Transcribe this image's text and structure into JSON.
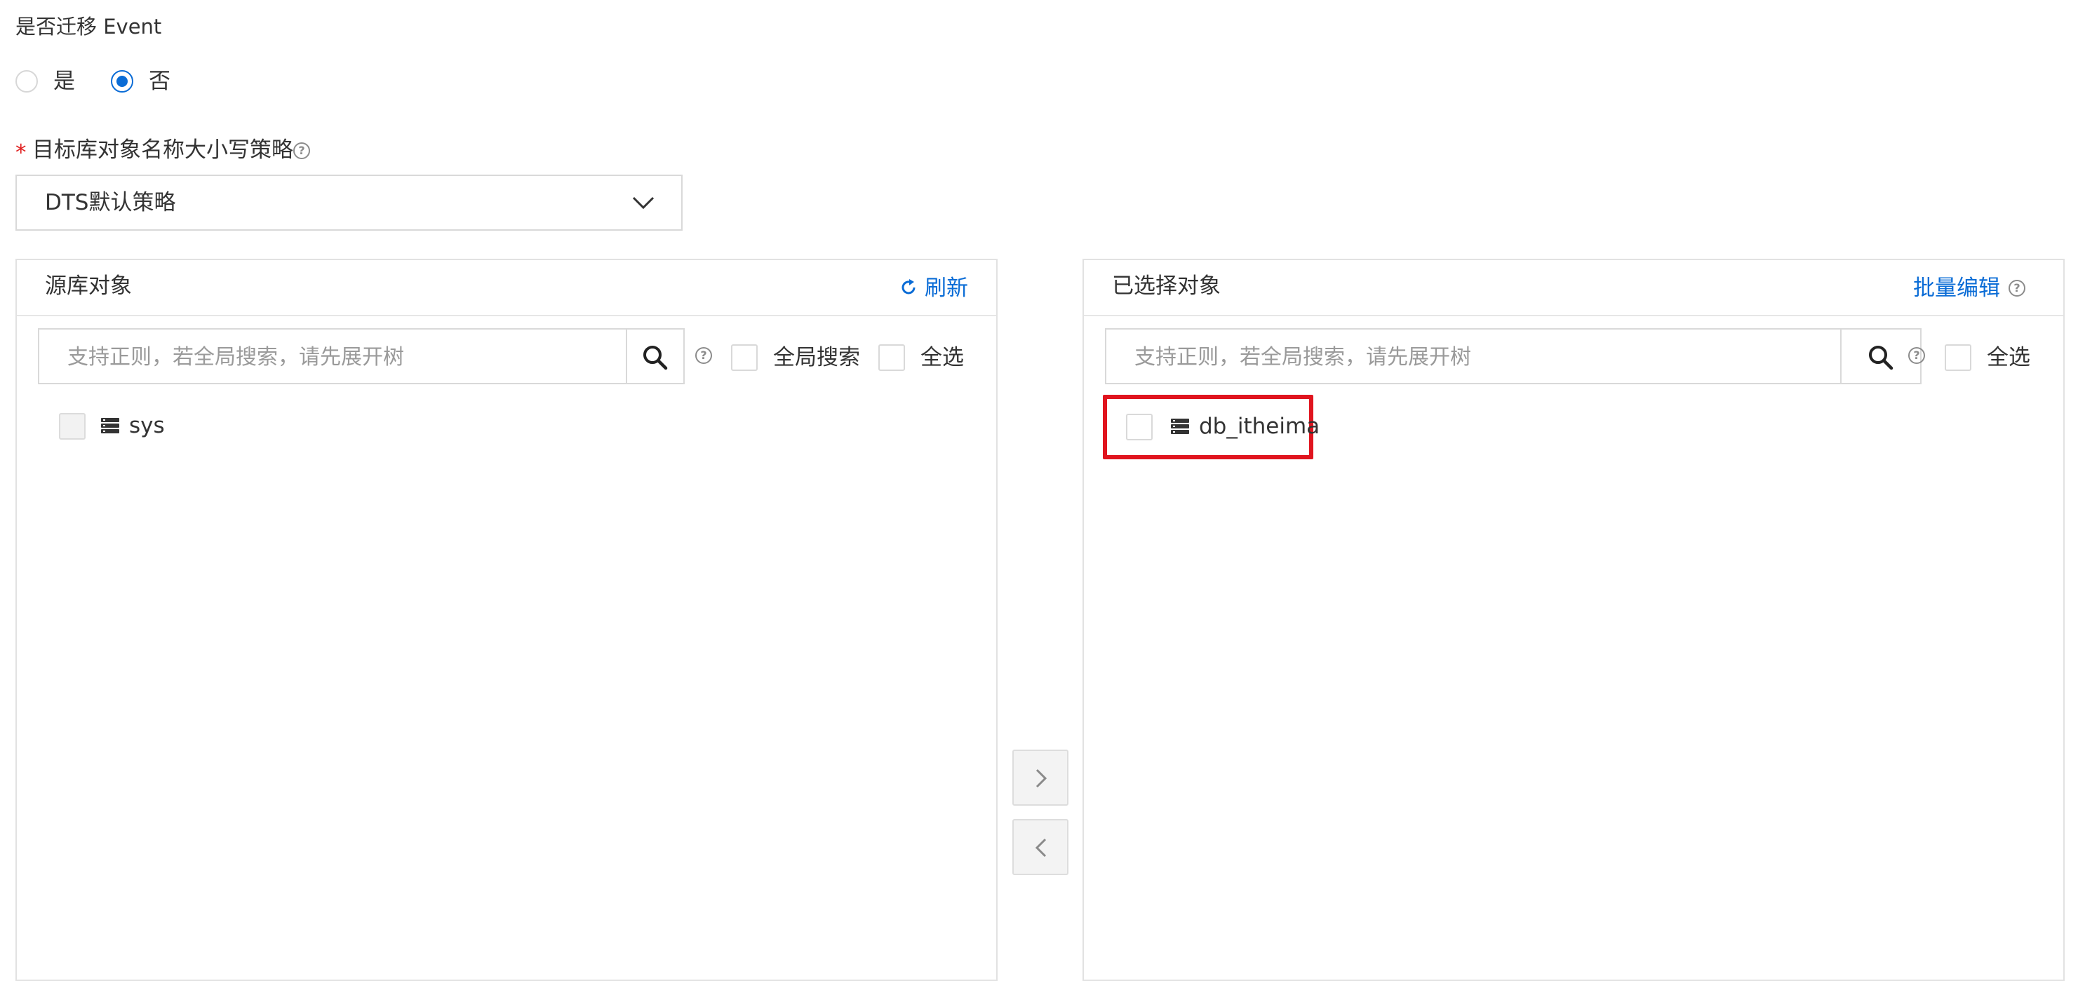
{
  "migrate_event": {
    "label": "是否迁移 Event",
    "options": [
      {
        "label": "是",
        "checked": false
      },
      {
        "label": "否",
        "checked": true
      }
    ]
  },
  "case_policy": {
    "required_mark": "*",
    "label": "目标库对象名称大小写策略",
    "selected": "DTS默认策略"
  },
  "source_panel": {
    "title": "源库对象",
    "refresh_label": "刷新",
    "search_placeholder": "支持正则，若全局搜索，请先展开树",
    "global_search_label": "全局搜索",
    "select_all_label": "全选",
    "items": [
      {
        "name": "sys"
      }
    ]
  },
  "selected_panel": {
    "title": "已选择对象",
    "batch_edit_label": "批量编辑",
    "search_placeholder": "支持正则，若全局搜索，请先展开树",
    "select_all_label": "全选",
    "items": [
      {
        "name": "db_itheima"
      }
    ]
  },
  "colors": {
    "accent": "#0a6cd6",
    "required": "#e02020",
    "highlight_box": "#e0141e"
  }
}
